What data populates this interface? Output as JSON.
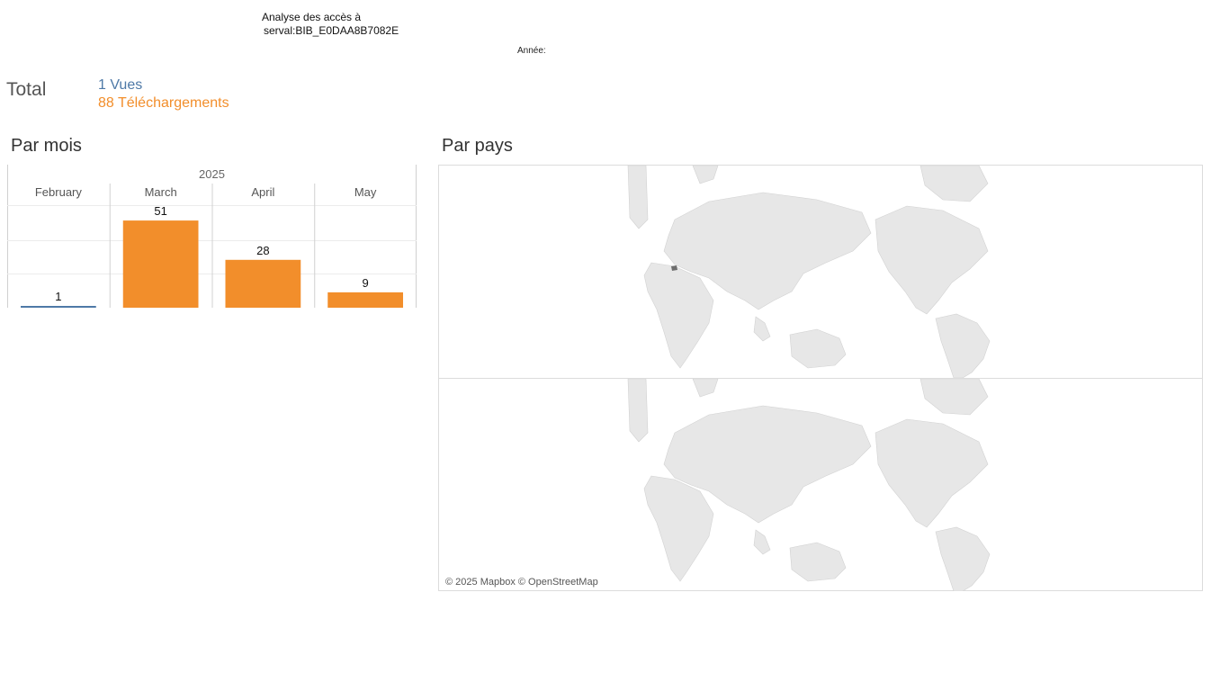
{
  "header": {
    "title_line1": "Analyse des accès à",
    "title_line2": "serval:BIB_E0DAA8B7082E",
    "year_filter_label": "Année:"
  },
  "totals": {
    "label": "Total",
    "views": "1 Vues",
    "downloads": "88 Téléchargements"
  },
  "sections": {
    "monthly_title": "Par mois",
    "country_title": "Par pays"
  },
  "colors": {
    "views": "#4e79a7",
    "downloads": "#f28e2b"
  },
  "chart_data": {
    "type": "bar",
    "title": "Par mois",
    "year": "2025",
    "categories": [
      "February",
      "March",
      "April",
      "May"
    ],
    "series": [
      {
        "name": "Vues",
        "values": [
          1,
          0,
          0,
          0
        ]
      },
      {
        "name": "Téléchargements",
        "values": [
          0,
          51,
          28,
          9
        ]
      }
    ],
    "data_labels": [
      "1",
      "51",
      "28",
      "9"
    ],
    "ylim": [
      0,
      60
    ],
    "grid": true
  },
  "map": {
    "credit": "© 2025 Mapbox © OpenStreetMap",
    "highlighted_country": "Switzerland"
  }
}
